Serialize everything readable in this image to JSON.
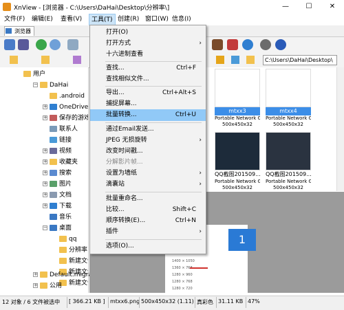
{
  "window": {
    "title": "XnView - [浏览器 - C:\\Users\\DaHai\\Desktop\\分辨率\\]",
    "minimize": "—",
    "maximize": "☐",
    "close": "✕"
  },
  "menubar": [
    {
      "label": "文件(F)"
    },
    {
      "label": "编辑(E)"
    },
    {
      "label": "查看(V)"
    },
    {
      "label": "工具(T)"
    },
    {
      "label": "创建(R)"
    },
    {
      "label": "窗口(W)"
    },
    {
      "label": "信息(I)"
    }
  ],
  "tab": {
    "label": "浏览器"
  },
  "path": {
    "value": "C:\\Users\\DaHai\\Desktop\\"
  },
  "tree": [
    {
      "label": "用户"
    },
    {
      "label": "DaHai"
    },
    {
      "label": ".android"
    },
    {
      "label": "OneDrive"
    },
    {
      "label": "保存的游戏"
    },
    {
      "label": "联系人"
    },
    {
      "label": "链接"
    },
    {
      "label": "视频"
    },
    {
      "label": "收藏夹"
    },
    {
      "label": "搜索"
    },
    {
      "label": "图片"
    },
    {
      "label": "文档"
    },
    {
      "label": "下载"
    },
    {
      "label": "音乐"
    },
    {
      "label": "桌面"
    },
    {
      "label": "qq"
    },
    {
      "label": "分辨率"
    },
    {
      "label": "新建文件"
    },
    {
      "label": "新建文件"
    },
    {
      "label": "新建文件"
    },
    {
      "label": "Default.migrat"
    },
    {
      "label": "公用"
    }
  ],
  "thumbnails": [
    {
      "name": "mtxx3",
      "type": "Portable Network Gr...",
      "size": "500x450x32",
      "selected": true
    },
    {
      "name": "mtxx4",
      "type": "Portable Network Gr...",
      "size": "500x450x32",
      "selected": true
    },
    {
      "name": "QQ截图201509...",
      "type": "Portable Network Gr...",
      "size": "500x450x32",
      "selected": false
    },
    {
      "name": "QQ截图201509...",
      "type": "Portable Network Gr...",
      "size": "500x450x32",
      "selected": false
    }
  ],
  "preview": {
    "badge": "1",
    "lines": [
      "1400 × 1050",
      "1360 × 768",
      "1280 × 960",
      "1280 × 768",
      "1280 × 720"
    ]
  },
  "tools_menu": {
    "items": [
      {
        "label": "打开(O)",
        "shortcut": "",
        "arrow": ""
      },
      {
        "label": "打开方式",
        "shortcut": "",
        "arrow": "›"
      },
      {
        "label": "十六进制查看",
        "shortcut": "",
        "arrow": ""
      },
      {
        "label": "查找...",
        "shortcut": "Ctrl+F",
        "arrow": ""
      },
      {
        "label": "查找相似文件...",
        "shortcut": "",
        "arrow": ""
      },
      {
        "label": "导出...",
        "shortcut": "Ctrl+Alt+S",
        "arrow": ""
      },
      {
        "label": "捕捉屏幕...",
        "shortcut": "",
        "arrow": ""
      },
      {
        "label": "批量转换...",
        "shortcut": "Ctrl+U",
        "arrow": ""
      },
      {
        "label": "通过Email发送...",
        "shortcut": "",
        "arrow": ""
      },
      {
        "label": "JPEG 无损旋转",
        "shortcut": "",
        "arrow": "›"
      },
      {
        "label": "改变时间戳...",
        "shortcut": "",
        "arrow": ""
      },
      {
        "label": "分解影片帧...",
        "shortcut": "",
        "arrow": ""
      },
      {
        "label": "设置为墙纸",
        "shortcut": "",
        "arrow": "›"
      },
      {
        "label": "滴囊站",
        "shortcut": "",
        "arrow": "›"
      },
      {
        "label": "批量重命名...",
        "shortcut": "",
        "arrow": ""
      },
      {
        "label": "比较...",
        "shortcut": "Shift+C",
        "arrow": ""
      },
      {
        "label": "顺序转换(E)...",
        "shortcut": "Ctrl+N",
        "arrow": ""
      },
      {
        "label": "插件",
        "shortcut": "",
        "arrow": "›"
      },
      {
        "label": "选项(O)...",
        "shortcut": "",
        "arrow": ""
      }
    ]
  },
  "status": {
    "count": "12 对象 / 6 文件被选中",
    "size": "[ 366.21 KB ]",
    "file": "mtxx6.png",
    "dims": "500x450x32 (1.11)",
    "color": "真彩色",
    "filesize": "31.11 KB",
    "zoom": "47%"
  },
  "colors": {
    "accent": "#3c8ee8",
    "highlight": "#91c9f7",
    "folder": "#f2c14e"
  }
}
